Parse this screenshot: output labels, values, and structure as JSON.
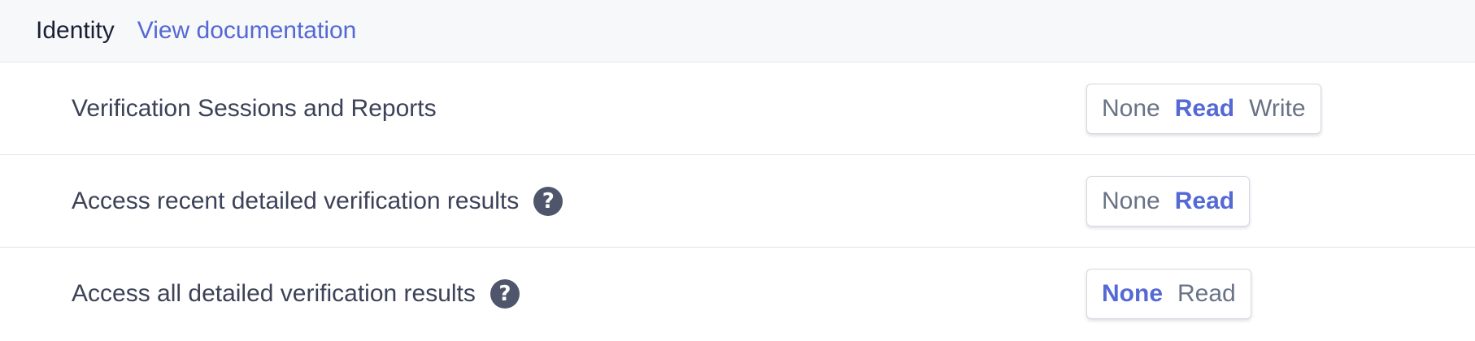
{
  "section": {
    "title": "Identity",
    "doc_link": "View documentation"
  },
  "permissions": [
    {
      "label": "Verification Sessions and Reports",
      "has_help": false,
      "options": [
        "None",
        "Read",
        "Write"
      ],
      "selected": "Read"
    },
    {
      "label": "Access recent detailed verification results",
      "has_help": true,
      "options": [
        "None",
        "Read"
      ],
      "selected": "Read"
    },
    {
      "label": "Access all detailed verification results",
      "has_help": true,
      "options": [
        "None",
        "Read"
      ],
      "selected": "None"
    }
  ],
  "icons": {
    "help": "question-circle-icon"
  },
  "colors": {
    "accent": "#5469d4",
    "text": "#3c4257",
    "muted": "#697386",
    "header_bg": "#f7f8fa",
    "icon": "#4f566b"
  }
}
